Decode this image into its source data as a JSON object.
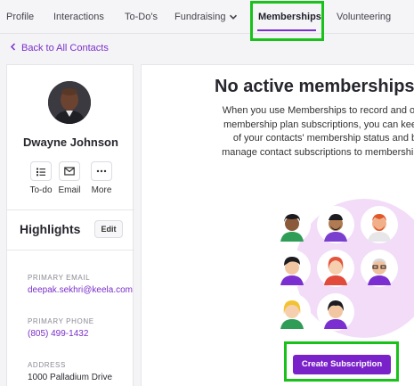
{
  "tabs": [
    {
      "label": "Profile"
    },
    {
      "label": "Interactions"
    },
    {
      "label": "To-Do's"
    },
    {
      "label": "Fundraising",
      "icon": "chevron-down-icon"
    },
    {
      "label": "Memberships",
      "active": true
    },
    {
      "label": "Volunteering"
    }
  ],
  "back_link": {
    "label": "Back to All Contacts",
    "icon": "chevron-left-icon"
  },
  "contact": {
    "name": "Dwayne Johnson",
    "actions": [
      {
        "label": "To-do",
        "icon": "todo-list-icon"
      },
      {
        "label": "Email",
        "icon": "envelope-icon"
      },
      {
        "label": "More",
        "icon": "more-dots-icon"
      }
    ]
  },
  "highlights": {
    "title": "Highlights",
    "edit_label": "Edit",
    "fields": [
      {
        "label": "PRIMARY EMAIL",
        "value": "deepak.sekhri@keela.com"
      },
      {
        "label": "PRIMARY PHONE",
        "value": "(805) 499-1432"
      },
      {
        "label": "ADDRESS",
        "value": "1000 Palladium Drive"
      }
    ]
  },
  "memberships": {
    "empty_title": "No active memberships",
    "empty_description": "When you use Memberships to record and organize membership plan subscriptions, you can keep track of your contacts' membership status and better manage contact subscriptions to membership plans.",
    "cta_label": "Create Subscription"
  },
  "colors": {
    "accent": "#7a22c9",
    "highlight_box": "#18c21a",
    "illustration_bg": "#f2dcf8"
  }
}
